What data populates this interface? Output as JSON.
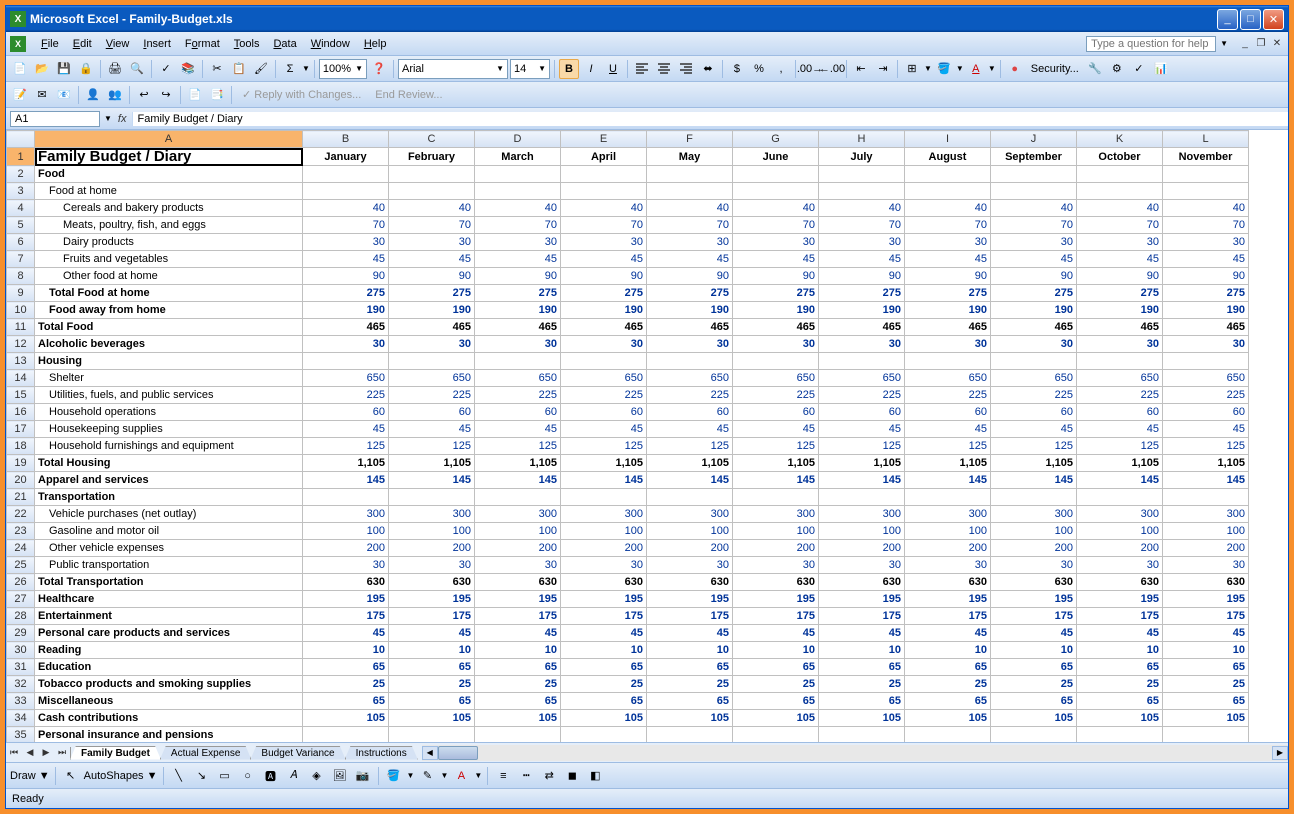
{
  "titlebar": {
    "app": "Microsoft Excel",
    "doc": "Family-Budget.xls"
  },
  "menu": {
    "file": "File",
    "edit": "Edit",
    "view": "View",
    "insert": "Insert",
    "format": "Format",
    "tools": "Tools",
    "data": "Data",
    "window": "Window",
    "help": "Help"
  },
  "helpbox": {
    "placeholder": "Type a question for help"
  },
  "toolbar1": {
    "zoom": "100%",
    "font": "Arial",
    "size": "14",
    "security": "Security..."
  },
  "reviewbar": {
    "reply": "Reply with Changes...",
    "end": "End Review..."
  },
  "namebox": {
    "cell": "A1"
  },
  "formulabar": {
    "value": "Family Budget / Diary"
  },
  "columns": [
    "A",
    "B",
    "C",
    "D",
    "E",
    "F",
    "G",
    "H",
    "I",
    "J",
    "K",
    "L"
  ],
  "months": [
    "January",
    "February",
    "March",
    "April",
    "May",
    "June",
    "July",
    "August",
    "September",
    "October",
    "November"
  ],
  "rows": [
    {
      "n": 1,
      "label": "Family Budget / Diary",
      "vals": "months",
      "cls": "header-row",
      "ind": 0
    },
    {
      "n": 2,
      "label": "Food",
      "vals": [],
      "cls": "bold",
      "ind": 0
    },
    {
      "n": 3,
      "label": "Food at home",
      "vals": [],
      "cls": "",
      "ind": 1
    },
    {
      "n": 4,
      "label": "Cereals and bakery products",
      "vals": [
        40,
        40,
        40,
        40,
        40,
        40,
        40,
        40,
        40,
        40,
        40
      ],
      "cls": "",
      "ind": 2
    },
    {
      "n": 5,
      "label": "Meats, poultry, fish, and eggs",
      "vals": [
        70,
        70,
        70,
        70,
        70,
        70,
        70,
        70,
        70,
        70,
        70
      ],
      "cls": "",
      "ind": 2
    },
    {
      "n": 6,
      "label": "Dairy products",
      "vals": [
        30,
        30,
        30,
        30,
        30,
        30,
        30,
        30,
        30,
        30,
        30
      ],
      "cls": "",
      "ind": 2
    },
    {
      "n": 7,
      "label": "Fruits and vegetables",
      "vals": [
        45,
        45,
        45,
        45,
        45,
        45,
        45,
        45,
        45,
        45,
        45
      ],
      "cls": "",
      "ind": 2
    },
    {
      "n": 8,
      "label": "Other food at home",
      "vals": [
        90,
        90,
        90,
        90,
        90,
        90,
        90,
        90,
        90,
        90,
        90
      ],
      "cls": "",
      "ind": 2
    },
    {
      "n": 9,
      "label": "Total Food at home",
      "vals": [
        275,
        275,
        275,
        275,
        275,
        275,
        275,
        275,
        275,
        275,
        275
      ],
      "cls": "bold",
      "ind": 1
    },
    {
      "n": 10,
      "label": "Food away from home",
      "vals": [
        190,
        190,
        190,
        190,
        190,
        190,
        190,
        190,
        190,
        190,
        190
      ],
      "cls": "bold",
      "ind": 1
    },
    {
      "n": 11,
      "label": "Total Food",
      "vals": [
        465,
        465,
        465,
        465,
        465,
        465,
        465,
        465,
        465,
        465,
        465
      ],
      "cls": "bold totalrow",
      "ind": 0
    },
    {
      "n": 12,
      "label": "Alcoholic beverages",
      "vals": [
        30,
        30,
        30,
        30,
        30,
        30,
        30,
        30,
        30,
        30,
        30
      ],
      "cls": "bold",
      "ind": 0
    },
    {
      "n": 13,
      "label": "Housing",
      "vals": [],
      "cls": "bold",
      "ind": 0
    },
    {
      "n": 14,
      "label": "Shelter",
      "vals": [
        650,
        650,
        650,
        650,
        650,
        650,
        650,
        650,
        650,
        650,
        650
      ],
      "cls": "",
      "ind": 1
    },
    {
      "n": 15,
      "label": "Utilities, fuels, and public services",
      "vals": [
        225,
        225,
        225,
        225,
        225,
        225,
        225,
        225,
        225,
        225,
        225
      ],
      "cls": "",
      "ind": 1
    },
    {
      "n": 16,
      "label": "Household operations",
      "vals": [
        60,
        60,
        60,
        60,
        60,
        60,
        60,
        60,
        60,
        60,
        60
      ],
      "cls": "",
      "ind": 1
    },
    {
      "n": 17,
      "label": "Housekeeping supplies",
      "vals": [
        45,
        45,
        45,
        45,
        45,
        45,
        45,
        45,
        45,
        45,
        45
      ],
      "cls": "",
      "ind": 1
    },
    {
      "n": 18,
      "label": "Household furnishings and equipment",
      "vals": [
        125,
        125,
        125,
        125,
        125,
        125,
        125,
        125,
        125,
        125,
        125
      ],
      "cls": "",
      "ind": 1
    },
    {
      "n": 19,
      "label": "Total Housing",
      "vals": [
        "1,105",
        "1,105",
        "1,105",
        "1,105",
        "1,105",
        "1,105",
        "1,105",
        "1,105",
        "1,105",
        "1,105",
        "1,105"
      ],
      "cls": "bold totalrow",
      "ind": 0
    },
    {
      "n": 20,
      "label": "Apparel and services",
      "vals": [
        145,
        145,
        145,
        145,
        145,
        145,
        145,
        145,
        145,
        145,
        145
      ],
      "cls": "bold",
      "ind": 0
    },
    {
      "n": 21,
      "label": "Transportation",
      "vals": [],
      "cls": "bold",
      "ind": 0
    },
    {
      "n": 22,
      "label": "Vehicle purchases (net outlay)",
      "vals": [
        300,
        300,
        300,
        300,
        300,
        300,
        300,
        300,
        300,
        300,
        300
      ],
      "cls": "",
      "ind": 1
    },
    {
      "n": 23,
      "label": "Gasoline and motor oil",
      "vals": [
        100,
        100,
        100,
        100,
        100,
        100,
        100,
        100,
        100,
        100,
        100
      ],
      "cls": "",
      "ind": 1
    },
    {
      "n": 24,
      "label": "Other vehicle expenses",
      "vals": [
        200,
        200,
        200,
        200,
        200,
        200,
        200,
        200,
        200,
        200,
        200
      ],
      "cls": "",
      "ind": 1
    },
    {
      "n": 25,
      "label": "Public transportation",
      "vals": [
        30,
        30,
        30,
        30,
        30,
        30,
        30,
        30,
        30,
        30,
        30
      ],
      "cls": "",
      "ind": 1
    },
    {
      "n": 26,
      "label": "Total Transportation",
      "vals": [
        630,
        630,
        630,
        630,
        630,
        630,
        630,
        630,
        630,
        630,
        630
      ],
      "cls": "bold totalrow",
      "ind": 0
    },
    {
      "n": 27,
      "label": "Healthcare",
      "vals": [
        195,
        195,
        195,
        195,
        195,
        195,
        195,
        195,
        195,
        195,
        195
      ],
      "cls": "bold",
      "ind": 0
    },
    {
      "n": 28,
      "label": "Entertainment",
      "vals": [
        175,
        175,
        175,
        175,
        175,
        175,
        175,
        175,
        175,
        175,
        175
      ],
      "cls": "bold",
      "ind": 0
    },
    {
      "n": 29,
      "label": "Personal care products and services",
      "vals": [
        45,
        45,
        45,
        45,
        45,
        45,
        45,
        45,
        45,
        45,
        45
      ],
      "cls": "bold",
      "ind": 0
    },
    {
      "n": 30,
      "label": "Reading",
      "vals": [
        10,
        10,
        10,
        10,
        10,
        10,
        10,
        10,
        10,
        10,
        10
      ],
      "cls": "bold",
      "ind": 0
    },
    {
      "n": 31,
      "label": "Education",
      "vals": [
        65,
        65,
        65,
        65,
        65,
        65,
        65,
        65,
        65,
        65,
        65
      ],
      "cls": "bold",
      "ind": 0
    },
    {
      "n": 32,
      "label": "Tobacco products and smoking supplies",
      "vals": [
        25,
        25,
        25,
        25,
        25,
        25,
        25,
        25,
        25,
        25,
        25
      ],
      "cls": "bold",
      "ind": 0
    },
    {
      "n": 33,
      "label": "Miscellaneous",
      "vals": [
        65,
        65,
        65,
        65,
        65,
        65,
        65,
        65,
        65,
        65,
        65
      ],
      "cls": "bold",
      "ind": 0
    },
    {
      "n": 34,
      "label": "Cash contributions",
      "vals": [
        105,
        105,
        105,
        105,
        105,
        105,
        105,
        105,
        105,
        105,
        105
      ],
      "cls": "bold",
      "ind": 0
    },
    {
      "n": 35,
      "label": "Personal insurance and pensions",
      "vals": [],
      "cls": "bold",
      "ind": 0
    }
  ],
  "tabs": {
    "t1": "Family Budget",
    "t2": "Actual Expense",
    "t3": "Budget Variance",
    "t4": "Instructions"
  },
  "drawbar": {
    "draw": "Draw",
    "autoshapes": "AutoShapes"
  },
  "statusbar": {
    "status": "Ready"
  }
}
